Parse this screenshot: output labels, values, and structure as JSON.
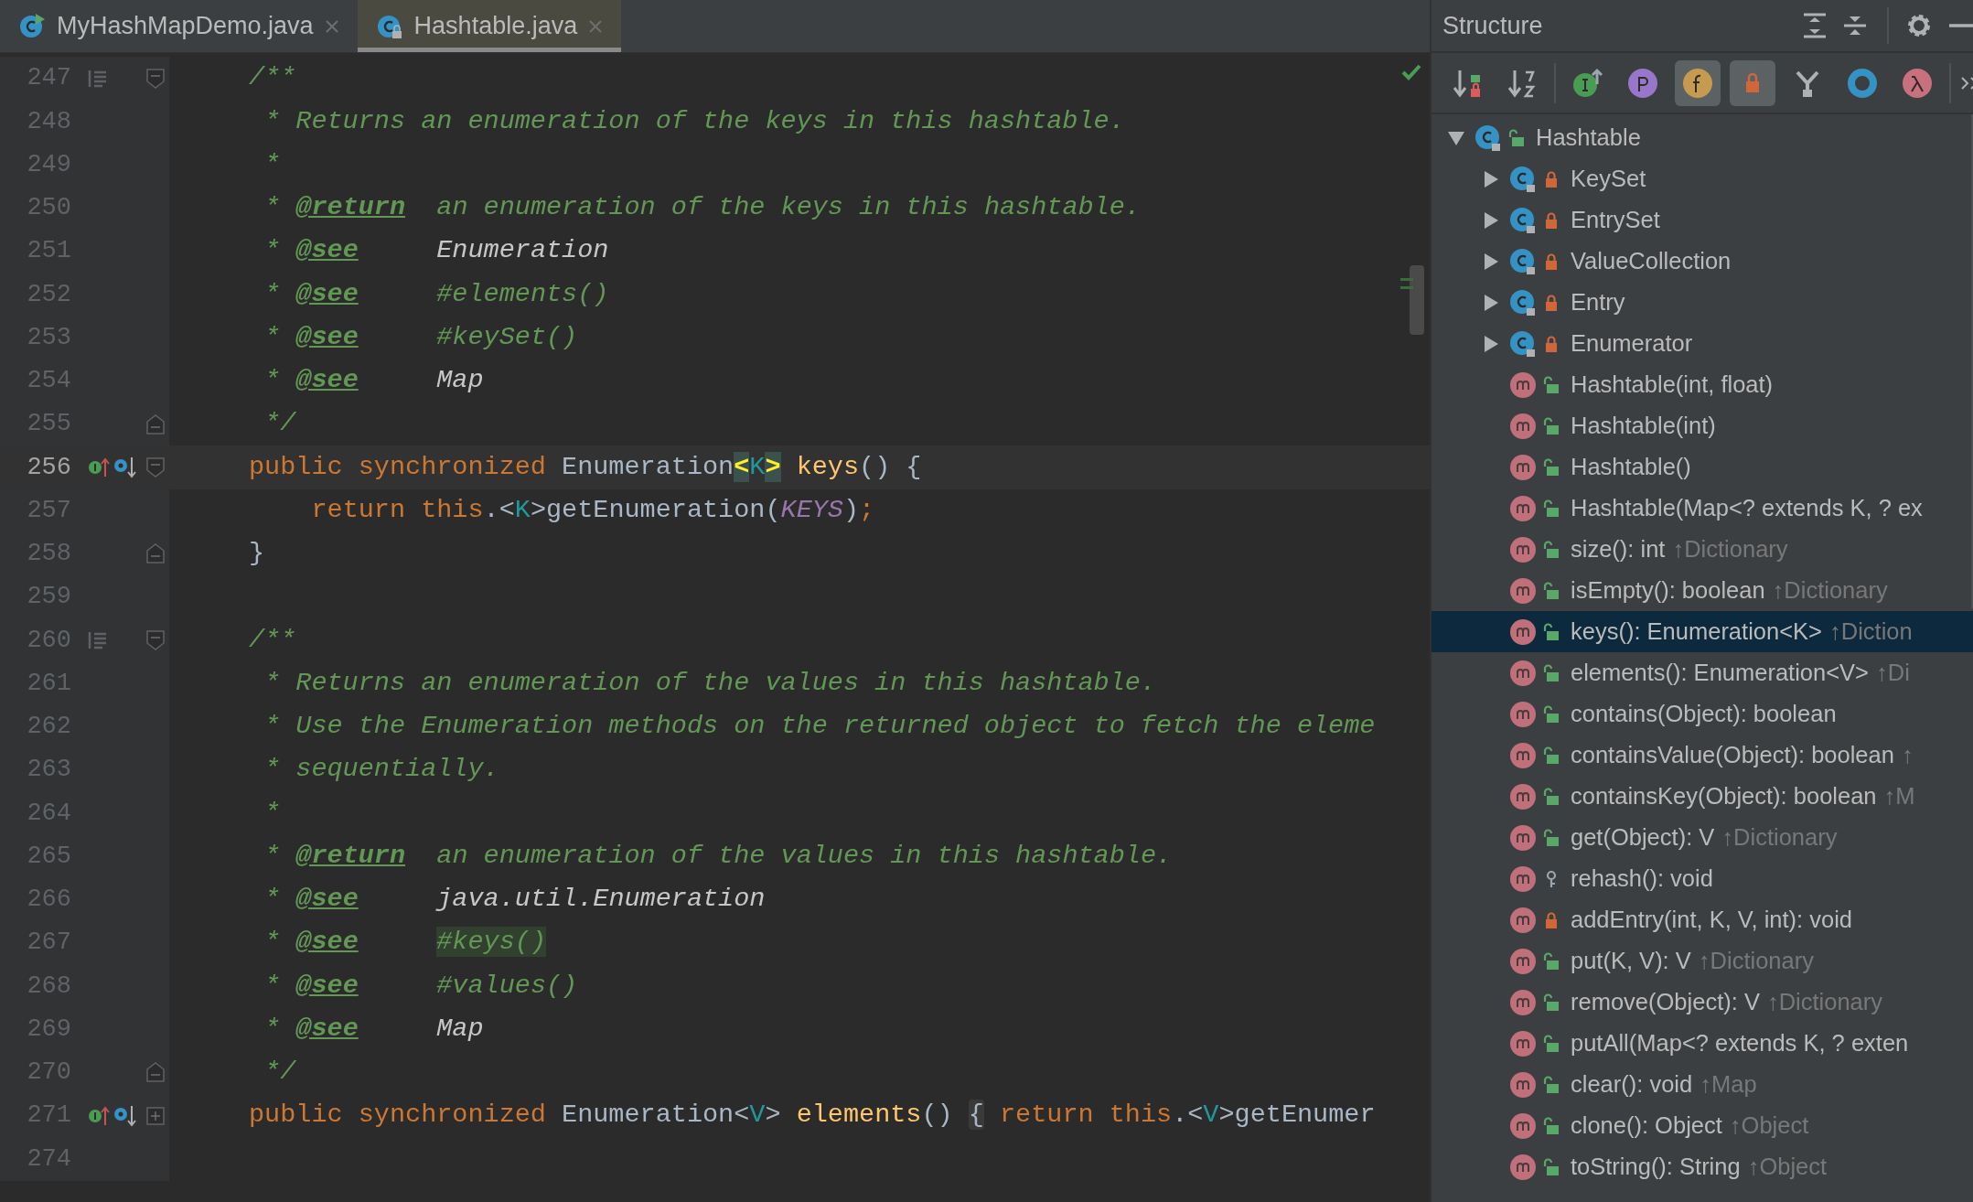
{
  "tabs": [
    {
      "label": "MyHashMapDemo.java",
      "kind": "runnable",
      "selected": false
    },
    {
      "label": "Hashtable.java",
      "kind": "locked",
      "selected": true
    }
  ],
  "editor": {
    "lines": [
      {
        "number": "247",
        "current": false,
        "marker": {
          "kind": "doc"
        },
        "fold": {
          "kind": "start"
        },
        "tokens": [
          {
            "kind": "comment",
            "text": "/**"
          }
        ]
      },
      {
        "number": "248",
        "current": false,
        "tokens": [
          {
            "kind": "comment",
            "text": " * Returns an enumeration of the keys in this hashtable."
          }
        ]
      },
      {
        "number": "249",
        "current": false,
        "tokens": [
          {
            "kind": "comment",
            "text": " *"
          }
        ]
      },
      {
        "number": "250",
        "current": false,
        "tokens": [
          {
            "kind": "comment",
            "text": " * "
          },
          {
            "kind": "tag",
            "text": "@return"
          },
          {
            "kind": "comment",
            "text": "  an enumeration of the keys in this hashtable."
          }
        ]
      },
      {
        "number": "251",
        "current": false,
        "tokens": [
          {
            "kind": "comment",
            "text": " * "
          },
          {
            "kind": "tag",
            "text": "@see"
          },
          {
            "kind": "ref",
            "text": "     Enumeration"
          }
        ]
      },
      {
        "number": "252",
        "current": false,
        "tokens": [
          {
            "kind": "comment",
            "text": " * "
          },
          {
            "kind": "tag",
            "text": "@see"
          },
          {
            "kind": "comment",
            "text": "     #elements()"
          }
        ]
      },
      {
        "number": "253",
        "current": false,
        "tokens": [
          {
            "kind": "comment",
            "text": " * "
          },
          {
            "kind": "tag",
            "text": "@see"
          },
          {
            "kind": "comment",
            "text": "     #keySet()"
          }
        ]
      },
      {
        "number": "254",
        "current": false,
        "tokens": [
          {
            "kind": "comment",
            "text": " * "
          },
          {
            "kind": "tag",
            "text": "@see"
          },
          {
            "kind": "ref",
            "text": "     Map"
          }
        ]
      },
      {
        "number": "255",
        "current": false,
        "fold": {
          "kind": "end"
        },
        "tokens": [
          {
            "kind": "comment",
            "text": " */"
          }
        ]
      },
      {
        "number": "256",
        "current": true,
        "marker": {
          "kind": "overrides"
        },
        "fold": {
          "kind": "start"
        },
        "tokens": [
          {
            "kind": "keyword",
            "text": "public synchronized "
          },
          {
            "kind": "type",
            "text": "Enumeration"
          },
          {
            "kind": "brace_match",
            "text": "<"
          },
          {
            "kind": "generic",
            "text": "K"
          },
          {
            "kind": "brace_match",
            "text": ">"
          },
          {
            "kind": "method",
            "text": " keys"
          },
          {
            "kind": "plain",
            "text": "() {"
          }
        ]
      },
      {
        "number": "257",
        "current": false,
        "tokens": [
          {
            "kind": "keyword",
            "text": "    return this"
          },
          {
            "kind": "plain",
            "text": ".<"
          },
          {
            "kind": "generic",
            "text": "K"
          },
          {
            "kind": "plain",
            "text": ">getEnumeration("
          },
          {
            "kind": "constant",
            "text": "KEYS"
          },
          {
            "kind": "plain",
            "text": ")"
          },
          {
            "kind": "keyword",
            "text": ";"
          }
        ]
      },
      {
        "number": "258",
        "current": false,
        "fold": {
          "kind": "end"
        },
        "tokens": [
          {
            "kind": "plain",
            "text": "}"
          }
        ]
      },
      {
        "number": "259",
        "current": false
      },
      {
        "number": "260",
        "current": false,
        "marker": {
          "kind": "doc"
        },
        "fold": {
          "kind": "start"
        },
        "tokens": [
          {
            "kind": "comment",
            "text": "/**"
          }
        ]
      },
      {
        "number": "261",
        "current": false,
        "tokens": [
          {
            "kind": "comment",
            "text": " * Returns an enumeration of the values in this hashtable."
          }
        ]
      },
      {
        "number": "262",
        "current": false,
        "tokens": [
          {
            "kind": "comment",
            "text": " * Use the Enumeration methods on the returned object to fetch the eleme"
          }
        ]
      },
      {
        "number": "263",
        "current": false,
        "tokens": [
          {
            "kind": "comment",
            "text": " * sequentially."
          }
        ]
      },
      {
        "number": "264",
        "current": false,
        "tokens": [
          {
            "kind": "comment",
            "text": " *"
          }
        ]
      },
      {
        "number": "265",
        "current": false,
        "tokens": [
          {
            "kind": "comment",
            "text": " * "
          },
          {
            "kind": "tag",
            "text": "@return"
          },
          {
            "kind": "comment",
            "text": "  an enumeration of the values in this hashtable."
          }
        ]
      },
      {
        "number": "266",
        "current": false,
        "tokens": [
          {
            "kind": "comment",
            "text": " * "
          },
          {
            "kind": "tag",
            "text": "@see"
          },
          {
            "kind": "ref",
            "text": "     java.util.Enumeration"
          }
        ]
      },
      {
        "number": "267",
        "current": false,
        "tokens": [
          {
            "kind": "comment",
            "text": " * "
          },
          {
            "kind": "tag",
            "text": "@see"
          },
          {
            "kind": "match",
            "text": "     #keys()"
          }
        ]
      },
      {
        "number": "268",
        "current": false,
        "tokens": [
          {
            "kind": "comment",
            "text": " * "
          },
          {
            "kind": "tag",
            "text": "@see"
          },
          {
            "kind": "comment",
            "text": "     #values()"
          }
        ]
      },
      {
        "number": "269",
        "current": false,
        "tokens": [
          {
            "kind": "comment",
            "text": " * "
          },
          {
            "kind": "tag",
            "text": "@see"
          },
          {
            "kind": "ref",
            "text": "     Map"
          }
        ]
      },
      {
        "number": "270",
        "current": false,
        "fold": {
          "kind": "end"
        },
        "tokens": [
          {
            "kind": "comment",
            "text": " */"
          }
        ]
      },
      {
        "number": "271",
        "current": false,
        "marker": {
          "kind": "overrides"
        },
        "fold": {
          "kind": "collapsed"
        },
        "tokens": [
          {
            "kind": "keyword",
            "text": "public synchronized "
          },
          {
            "kind": "type",
            "text": "Enumeration"
          },
          {
            "kind": "plain",
            "text": "<"
          },
          {
            "kind": "generic",
            "text": "V"
          },
          {
            "kind": "plain",
            "text": "> "
          },
          {
            "kind": "method",
            "text": "elements"
          },
          {
            "kind": "plain",
            "text": "() "
          },
          {
            "kind": "folded",
            "text": "{"
          },
          {
            "kind": "keyword",
            "text": " return this"
          },
          {
            "kind": "plain",
            "text": ".<"
          },
          {
            "kind": "generic",
            "text": "V"
          },
          {
            "kind": "plain",
            "text": ">getEnumer"
          }
        ]
      },
      {
        "number": "274",
        "current": false
      }
    ]
  },
  "structure": {
    "title": "Structure",
    "toolbar": [
      {
        "kind": "sort_visibility",
        "selected": false
      },
      {
        "kind": "sort_alpha",
        "selected": false
      },
      {
        "kind": "inherited",
        "selected": false
      },
      {
        "kind": "properties",
        "selected": false
      },
      {
        "kind": "fields",
        "selected": true
      },
      {
        "kind": "non_public",
        "selected": true
      },
      {
        "kind": "anonymous",
        "selected": false
      },
      {
        "kind": "lambdas_circle",
        "selected": false
      },
      {
        "kind": "lambda",
        "selected": false
      }
    ],
    "tree": [
      {
        "kind": "class",
        "name": "Hashtable",
        "lock": {
          "kind": "public"
        },
        "expanded": true,
        "selected": false,
        "children": [
          {
            "kind": "class",
            "name": "KeySet",
            "lock": {
              "kind": "private"
            },
            "expanded": false,
            "selected": false
          },
          {
            "kind": "class",
            "name": "EntrySet",
            "lock": {
              "kind": "private"
            },
            "expanded": false,
            "selected": false
          },
          {
            "kind": "class",
            "name": "ValueCollection",
            "lock": {
              "kind": "private"
            },
            "expanded": false,
            "selected": false
          },
          {
            "kind": "class",
            "name": "Entry",
            "lock": {
              "kind": "private"
            },
            "expanded": false,
            "selected": false
          },
          {
            "kind": "class",
            "name": "Enumerator",
            "lock": {
              "kind": "private"
            },
            "expanded": false,
            "selected": false
          },
          {
            "kind": "method",
            "name": "Hashtable(int, float)",
            "lock": {
              "kind": "public"
            },
            "selected": false
          },
          {
            "kind": "method",
            "name": "Hashtable(int)",
            "lock": {
              "kind": "public"
            },
            "selected": false
          },
          {
            "kind": "method",
            "name": "Hashtable()",
            "lock": {
              "kind": "public"
            },
            "selected": false
          },
          {
            "kind": "method",
            "name": "Hashtable(Map<? extends K, ? ex",
            "lock": {
              "kind": "public"
            },
            "selected": false
          },
          {
            "kind": "method",
            "name": "size(): int",
            "origin": "↑Dictionary",
            "lock": {
              "kind": "public"
            },
            "selected": false
          },
          {
            "kind": "method",
            "name": "isEmpty(): boolean",
            "origin": "↑Dictionary",
            "lock": {
              "kind": "public"
            },
            "selected": false
          },
          {
            "kind": "method",
            "name": "keys(): Enumeration<K>",
            "origin": "↑Diction",
            "lock": {
              "kind": "public"
            },
            "selected": true
          },
          {
            "kind": "method",
            "name": "elements(): Enumeration<V>",
            "origin": "↑Di",
            "lock": {
              "kind": "public"
            },
            "selected": false
          },
          {
            "kind": "method",
            "name": "contains(Object): boolean",
            "lock": {
              "kind": "public"
            },
            "selected": false
          },
          {
            "kind": "method",
            "name": "containsValue(Object): boolean",
            "origin": "↑",
            "lock": {
              "kind": "public"
            },
            "selected": false
          },
          {
            "kind": "method",
            "name": "containsKey(Object): boolean",
            "origin": "↑M",
            "lock": {
              "kind": "public"
            },
            "selected": false
          },
          {
            "kind": "method",
            "name": "get(Object): V",
            "origin": "↑Dictionary",
            "lock": {
              "kind": "public"
            },
            "selected": false
          },
          {
            "kind": "method",
            "name": "rehash(): void",
            "lock": {
              "kind": "protected"
            },
            "selected": false
          },
          {
            "kind": "method",
            "name": "addEntry(int, K, V, int): void",
            "lock": {
              "kind": "private"
            },
            "selected": false
          },
          {
            "kind": "method",
            "name": "put(K, V): V",
            "origin": "↑Dictionary",
            "lock": {
              "kind": "public"
            },
            "selected": false
          },
          {
            "kind": "method",
            "name": "remove(Object): V",
            "origin": "↑Dictionary",
            "lock": {
              "kind": "public"
            },
            "selected": false
          },
          {
            "kind": "method",
            "name": "putAll(Map<? extends K, ? exten",
            "lock": {
              "kind": "public"
            },
            "selected": false
          },
          {
            "kind": "method",
            "name": "clear(): void",
            "origin": "↑Map",
            "lock": {
              "kind": "public"
            },
            "selected": false
          },
          {
            "kind": "method",
            "name": "clone(): Object",
            "origin": "↑Object",
            "lock": {
              "kind": "public"
            },
            "selected": false
          },
          {
            "kind": "method",
            "name": "toString(): String",
            "origin": "↑Object",
            "lock": {
              "kind": "public"
            },
            "selected": false
          }
        ]
      }
    ]
  }
}
